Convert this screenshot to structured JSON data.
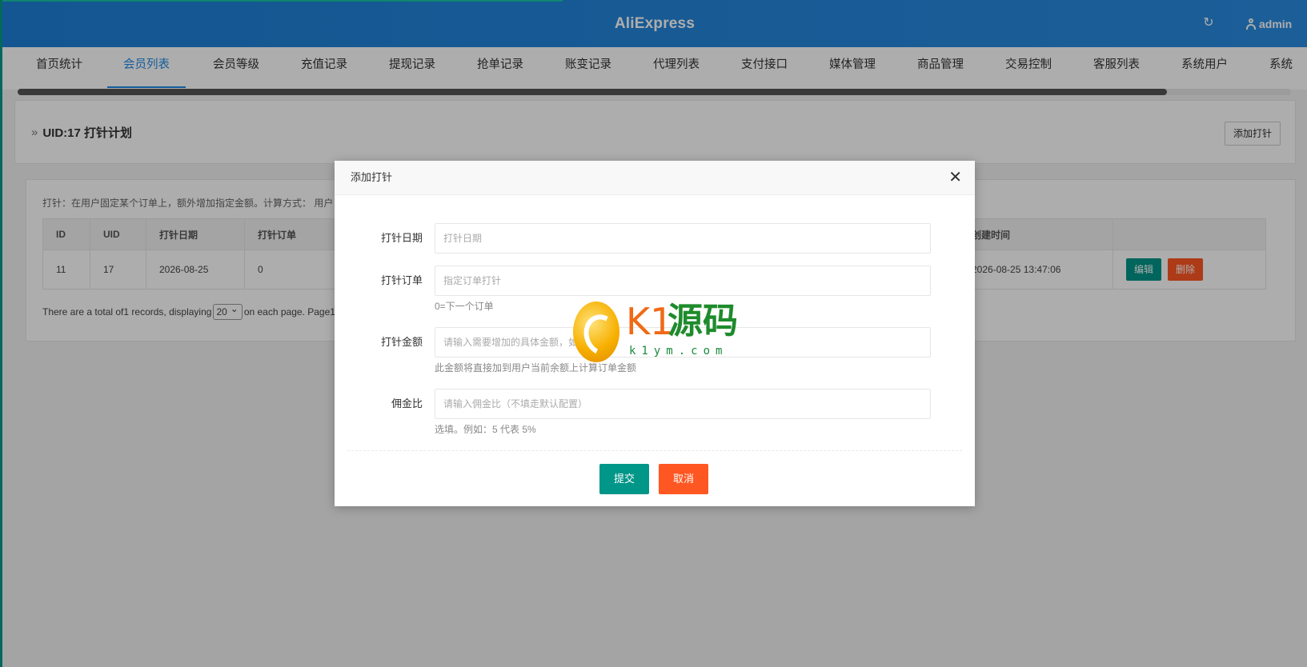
{
  "header": {
    "brand": "AliExpress",
    "user": "admin"
  },
  "nav": {
    "tabs": [
      {
        "label": "首页统计"
      },
      {
        "label": "会员列表",
        "active": true
      },
      {
        "label": "会员等级"
      },
      {
        "label": "充值记录"
      },
      {
        "label": "提现记录"
      },
      {
        "label": "抢单记录"
      },
      {
        "label": "账变记录"
      },
      {
        "label": "代理列表"
      },
      {
        "label": "支付接口"
      },
      {
        "label": "媒体管理"
      },
      {
        "label": "商品管理"
      },
      {
        "label": "交易控制"
      },
      {
        "label": "客服列表"
      },
      {
        "label": "系统用户"
      },
      {
        "label": "系统"
      }
    ]
  },
  "page": {
    "title": "UID:17 打针计划",
    "add_button": "添加打针",
    "note": "打针：在用户固定某个订单上，额外增加指定金额。计算方式： 用户",
    "table": {
      "headers": [
        "ID",
        "UID",
        "打针日期",
        "打针订单",
        "创建时间"
      ],
      "rows": [
        {
          "id": "11",
          "uid": "17",
          "date": "2026-08-25",
          "order": "0",
          "created": "2026-08-25 13:47:06"
        }
      ],
      "edit_label": "编辑",
      "delete_label": "删除"
    },
    "pager": {
      "prefix": "There are a total of1 records, displaying",
      "page_size": "20",
      "suffix": "on each page. Page1"
    }
  },
  "modal": {
    "title": "添加打针",
    "fields": [
      {
        "label": "打针日期",
        "placeholder": "打针日期",
        "hint": ""
      },
      {
        "label": "打针订单",
        "placeholder": "指定订单打针",
        "hint": "0=下一个订单"
      },
      {
        "label": "打针金额",
        "placeholder": "请输入需要增加的具体金额，如",
        "hint": "此金额将直接加到用户当前余额上计算订单金额"
      },
      {
        "label": "佣金比",
        "placeholder": "请输入佣金比（不填走默认配置）",
        "hint": "选填。例如：5 代表 5%"
      }
    ],
    "submit": "提交",
    "cancel": "取消"
  },
  "watermark": {
    "text_k1": "K1",
    "text_yuanma": "源码",
    "domain": "k1ym.com"
  }
}
